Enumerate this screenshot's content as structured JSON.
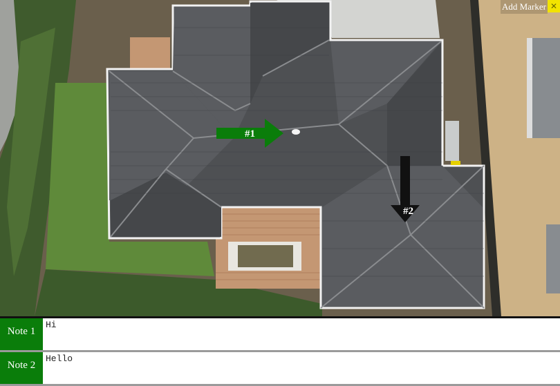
{
  "toolbar": {
    "add_marker_label": "Add Marker",
    "close_icon": "close-icon",
    "close_glyph": "✕"
  },
  "markers": [
    {
      "label": "#1",
      "color": "#0a7d0a",
      "direction": "right"
    },
    {
      "label": "#2",
      "color": "#111111",
      "direction": "down"
    }
  ],
  "notes": [
    {
      "label": "Note 1",
      "text": "Hi"
    },
    {
      "label": "Note 2",
      "text": "Hello"
    }
  ],
  "colors": {
    "note_label_bg": "#0a7d0a",
    "close_button_bg": "#f2e300"
  }
}
